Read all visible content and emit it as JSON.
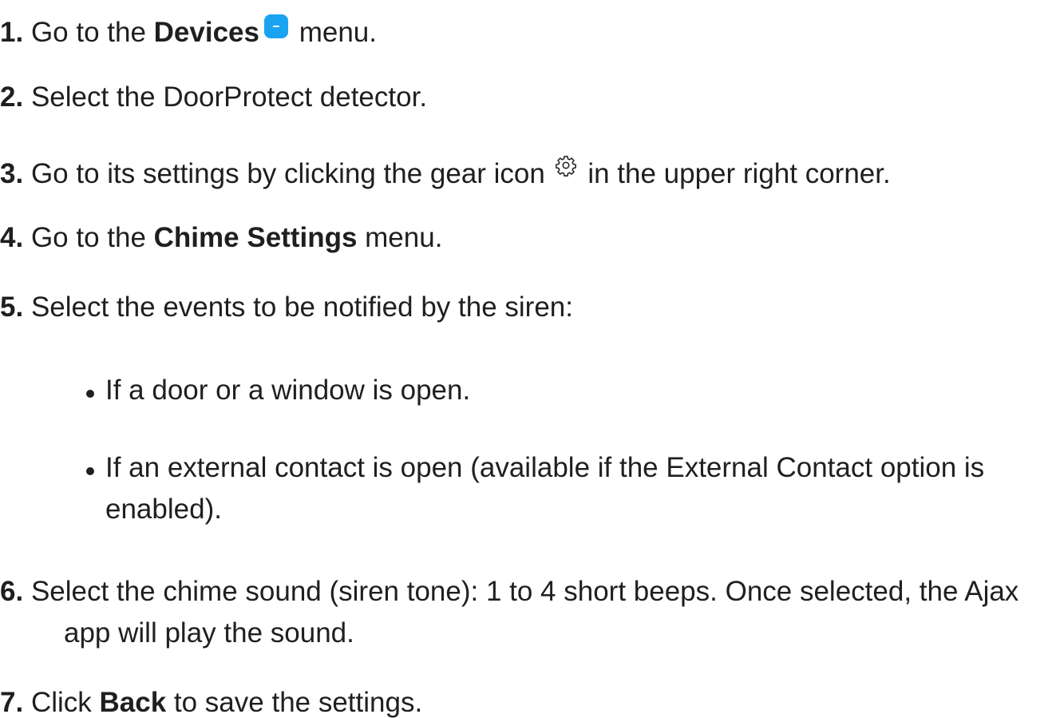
{
  "steps": [
    {
      "num": "1.",
      "pre": "Go to the ",
      "bold": "Devices",
      "post": " menu.",
      "icon": "devices-icon"
    },
    {
      "num": "2.",
      "text": "Select the DoorProtect detector."
    },
    {
      "num": "3.",
      "pre": "Go to its settings by clicking the gear icon ",
      "post": " in the upper right corner.",
      "icon": "gear-icon"
    },
    {
      "num": "4.",
      "pre": "Go to the ",
      "bold": "Chime Settings",
      "post": " menu."
    },
    {
      "num": "5.",
      "text": "Select the events to be notified by the siren:"
    },
    {
      "num": "6.",
      "line1": "Select the chime sound (siren tone): 1 to 4 short beeps. Once selected, the Ajax",
      "line2": "app will play the sound."
    },
    {
      "num": "7.",
      "pre": "Click ",
      "bold": "Back",
      "post": " to save the settings."
    }
  ],
  "bullets": [
    {
      "line1": "If a door or a window is open."
    },
    {
      "line1": "If an external contact is open (available if the External Contact option is",
      "line2": "enabled)."
    }
  ],
  "colors": {
    "text": "#1f1f1f",
    "devices_icon": "#1aa3f0",
    "background": "#ffffff"
  }
}
